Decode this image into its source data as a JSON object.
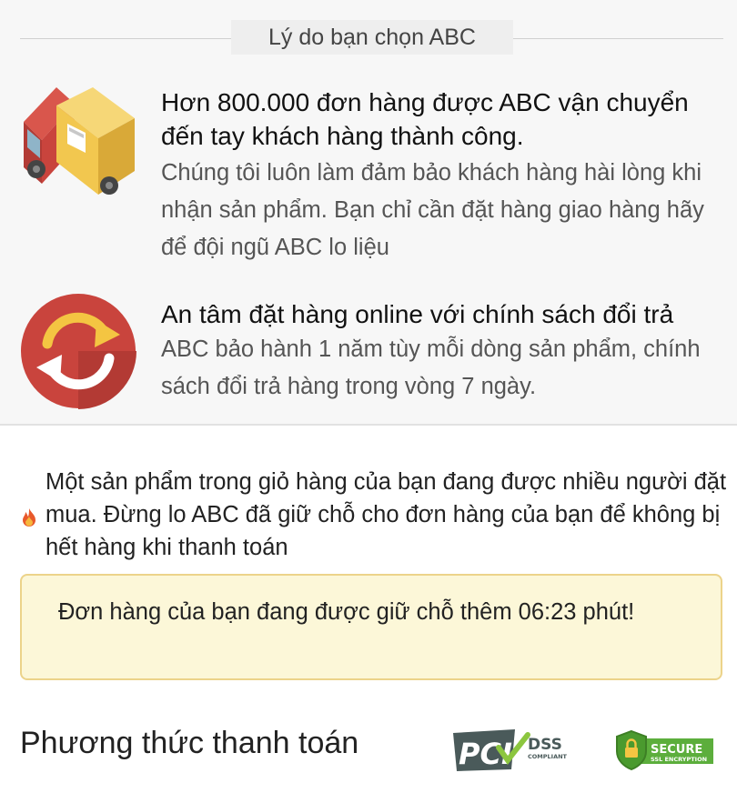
{
  "section": {
    "title": "Lý do bạn chọn ABC"
  },
  "reasons": [
    {
      "icon": "delivery-truck-icon",
      "heading": "Hơn 800.000 đơn hàng được ABC vận chuyển đến tay khách hàng thành công.",
      "description": "Chúng tôi luôn làm đảm bảo khách hàng hài lòng khi nhận sản phẩm. Bạn chỉ cần đặt hàng giao hàng hãy để đội ngũ ABC lo liệu"
    },
    {
      "icon": "exchange-arrows-icon",
      "heading": "An tâm đặt hàng online với chính sách đổi trả",
      "description": "ABC bảo hành 1 năm tùy mỗi dòng sản phẩm, chính sách đổi trả hàng trong vòng 7 ngày."
    }
  ],
  "notice": {
    "icon": "flame-icon",
    "text": "Một sản phẩm trong giỏ hàng của bạn đang được nhiều người đặt mua. Đừng lo ABC đã giữ chỗ cho đơn hàng của bạn để không bị hết hàng khi thanh toán"
  },
  "hold": {
    "text": "Đơn hàng của bạn đang được giữ chỗ thêm 06:23 phút!"
  },
  "payment": {
    "title": "Phương thức thanh toán",
    "badges": {
      "pci": {
        "logo": "PCI",
        "line1": "DSS",
        "line2": "COMPLIANT"
      },
      "ssl": {
        "line1": "SECURE",
        "line2": "SSL ENCRYPTION"
      }
    }
  },
  "colors": {
    "section_bg": "#f7f7f7",
    "hold_bg": "#fcf7d8",
    "hold_border": "#ecd38a",
    "truck_red": "#c9443d",
    "truck_yellow": "#f2c74f",
    "refresh_red": "#c9443d",
    "refresh_yellow": "#f4c542",
    "ssl_green": "#5cae3c"
  }
}
